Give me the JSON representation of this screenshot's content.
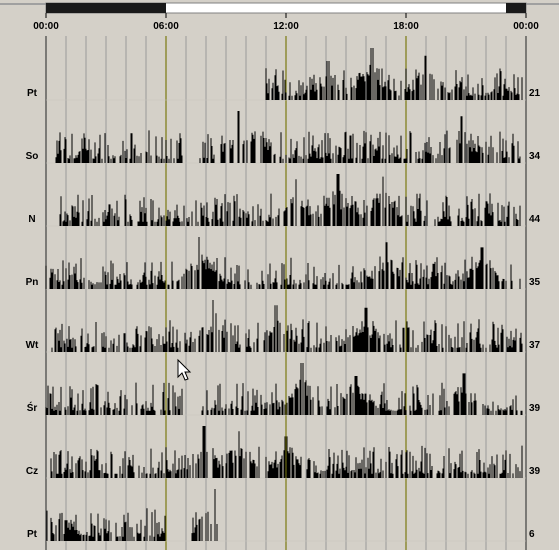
{
  "chart_data": {
    "type": "bar",
    "x_unit": "time of day",
    "xlim": [
      "00:00",
      "24:00"
    ],
    "x_ticks": [
      "00:00",
      "06:00",
      "12:00",
      "18:00",
      "00:00"
    ],
    "timeline": {
      "dark_segments": [
        [
          0.0,
          6.0
        ],
        [
          23.0,
          24.0
        ]
      ]
    },
    "rows": [
      {
        "label": "Pt",
        "count": "21",
        "active_hours": [
          [
            11.0,
            23.8
          ]
        ],
        "peaks": [
          [
            16.3,
            1.0
          ],
          [
            14.1,
            0.75
          ],
          [
            19.0,
            0.85
          ]
        ]
      },
      {
        "label": "So",
        "count": "34",
        "active_hours": [
          [
            0.5,
            6.8
          ],
          [
            7.7,
            23.7
          ]
        ],
        "peaks": [
          [
            9.6,
            1.0
          ],
          [
            10.6,
            0.9
          ],
          [
            20.8,
            0.9
          ]
        ]
      },
      {
        "label": "N",
        "count": "44",
        "active_hours": [
          [
            0.7,
            23.7
          ]
        ],
        "peaks": [
          [
            14.6,
            1.0
          ],
          [
            16.8,
            0.95
          ],
          [
            12.5,
            0.9
          ]
        ]
      },
      {
        "label": "Pn",
        "count": "35",
        "active_hours": [
          [
            0.0,
            23.7
          ]
        ],
        "peaks": [
          [
            7.7,
            1.0
          ],
          [
            17.0,
            0.9
          ],
          [
            21.8,
            0.8
          ]
        ]
      },
      {
        "label": "Wt",
        "count": "37",
        "active_hours": [
          [
            0.3,
            23.8
          ]
        ],
        "peaks": [
          [
            8.4,
            1.0
          ],
          [
            11.5,
            0.9
          ],
          [
            16.0,
            0.85
          ]
        ]
      },
      {
        "label": "Śr",
        "count": "39",
        "active_hours": [
          [
            0.0,
            6.8
          ],
          [
            7.8,
            23.8
          ]
        ],
        "peaks": [
          [
            12.8,
            1.0
          ],
          [
            15.5,
            0.75
          ],
          [
            20.9,
            0.8
          ]
        ]
      },
      {
        "label": "Cz",
        "count": "39",
        "active_hours": [
          [
            0.2,
            23.8
          ]
        ],
        "peaks": [
          [
            7.9,
            1.0
          ],
          [
            9.6,
            0.9
          ],
          [
            12.0,
            0.8
          ]
        ]
      },
      {
        "label": "Pt",
        "count": "6",
        "active_hours": [
          [
            0.0,
            6.0
          ],
          [
            7.3,
            8.7
          ]
        ],
        "peaks": [
          [
            8.4,
            1.0
          ],
          [
            1.0,
            0.4
          ]
        ]
      }
    ]
  }
}
